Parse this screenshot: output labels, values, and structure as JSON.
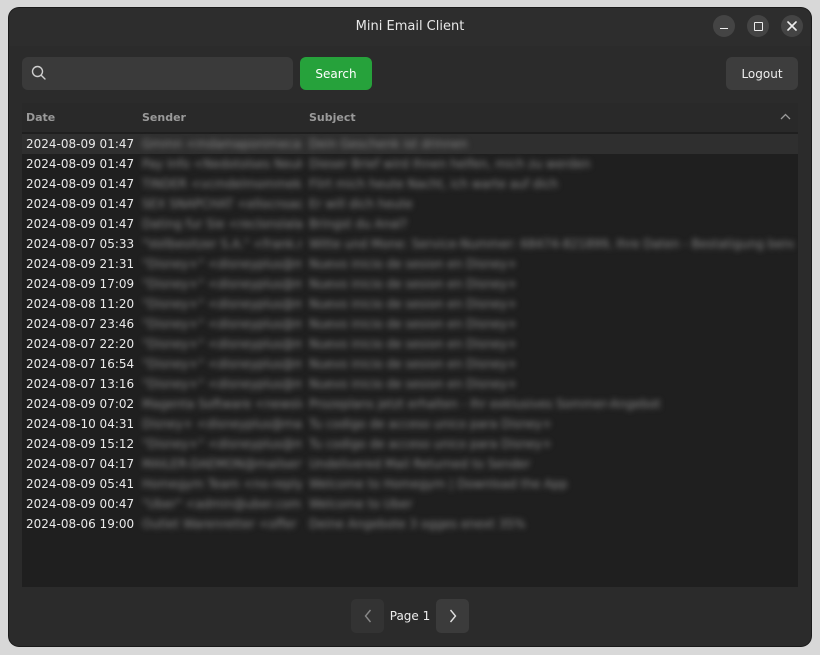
{
  "window": {
    "title": "Mini Email Client"
  },
  "search": {
    "placeholder": "",
    "value": "",
    "button_label": "Search"
  },
  "logout_label": "Logout",
  "table": {
    "headers": {
      "date": "Date",
      "sender": "Sender",
      "subject": "Subject"
    },
    "rows": [
      {
        "date": "2024-08-09 01:47",
        "sender": "Gmmn <mdamaponimecam",
        "subject": "Dein Geschenk ist drinnen"
      },
      {
        "date": "2024-08-09 01:47",
        "sender": "Pay Info <Nedotolses Neuke",
        "subject": "Dieser Brief wird Ihnen helfen, mich zu werden"
      },
      {
        "date": "2024-08-09 01:47",
        "sender": "TINDER <vcmdelmommeke",
        "subject": "Flirt mich heute Nacht, ich warte auf dich"
      },
      {
        "date": "2024-08-09 01:47",
        "sender": "SEX SNAPCHAT <ellocnsaom",
        "subject": "Er will dich heute"
      },
      {
        "date": "2024-08-09 01:47",
        "sender": "Dating fur Sie <reclonslalam",
        "subject": "Bringst du Anal?"
      },
      {
        "date": "2024-08-07 05:33",
        "sender": "\"Vollbesitzer S.A.\" <frank.ram",
        "subject": "Witte und Mone: Service-Nummer: 68474-821899, Ihre Daten - Bestatigung benotigt"
      },
      {
        "date": "2024-08-09 21:31",
        "sender": "\"Disney+\" <disneyplus@mail.",
        "subject": "Nuevo inicio de sesion en Disney+"
      },
      {
        "date": "2024-08-09 17:09",
        "sender": "\"Disney+\" <disneyplus@mail.",
        "subject": "Nuevo inicio de sesion en Disney+"
      },
      {
        "date": "2024-08-08 11:20",
        "sender": "\"Disney+\" <disneyplus@mail.",
        "subject": "Nuevo inicio de sesion en Disney+"
      },
      {
        "date": "2024-08-07 23:46",
        "sender": "\"Disney+\" <disneyplus@mail.",
        "subject": "Nuevo inicio de sesion en Disney+"
      },
      {
        "date": "2024-08-07 22:20",
        "sender": "\"Disney+\" <disneyplus@mail.",
        "subject": "Nuevo inicio de sesion en Disney+"
      },
      {
        "date": "2024-08-07 16:54",
        "sender": "\"Disney+\" <disneyplus@mail.",
        "subject": "Nuevo inicio de sesion en Disney+"
      },
      {
        "date": "2024-08-07 13:16",
        "sender": "\"Disney+\" <disneyplus@mail.",
        "subject": "Nuevo inicio de sesion en Disney+"
      },
      {
        "date": "2024-08-09 07:02",
        "sender": "Magenta Software <newslett",
        "subject": "Prozeplans jetzt erhalten - Ihr exklusives Sommer-Angebot"
      },
      {
        "date": "2024-08-10 04:31",
        "sender": "Disney+ <disneyplus@mail.c",
        "subject": "Tu codigo de acceso unico para Disney+"
      },
      {
        "date": "2024-08-09 15:12",
        "sender": "\"Disney+\" <disneyplus@mail.",
        "subject": "Tu codigo de acceso unico para Disney+"
      },
      {
        "date": "2024-08-07 04:17",
        "sender": "MAILER-DAEMON@mailserv.",
        "subject": "Undelivered Mail Returned to Sender"
      },
      {
        "date": "2024-08-09 05:41",
        "sender": "Homegym Team <no-reply@",
        "subject": "Welcome to Homegym | Download the App"
      },
      {
        "date": "2024-08-09 00:47",
        "sender": "\"Uber\" <admin@uber.com>",
        "subject": "Welcome to Uber"
      },
      {
        "date": "2024-08-06 19:00",
        "sender": "Outlet Warenretter <offer",
        "subject": "Deine Angebote 3 ogges enext 35%"
      }
    ]
  },
  "pagination": {
    "page_label": "Page 1"
  },
  "colors": {
    "accent": "#26a23b",
    "background": "#2b2b2b",
    "table_bg": "#1f1f1f"
  }
}
